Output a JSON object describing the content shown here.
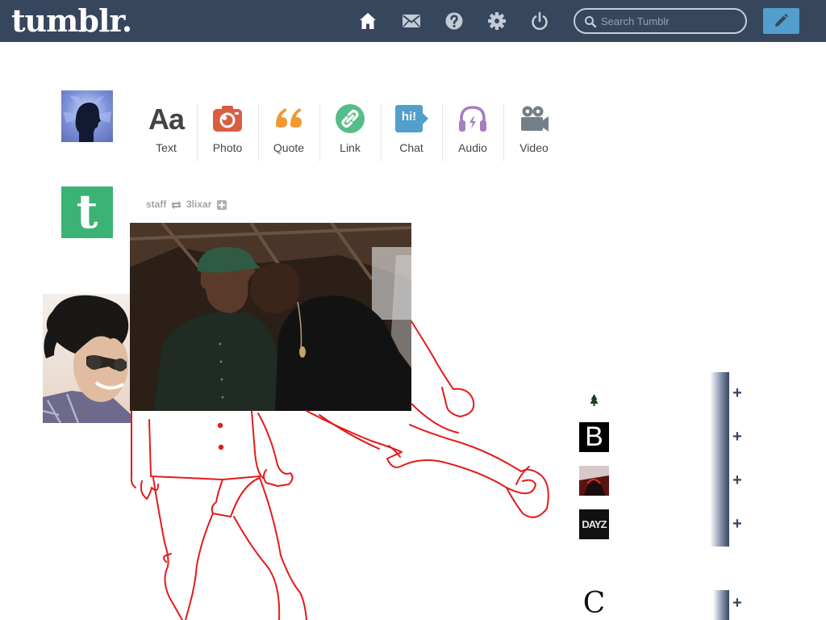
{
  "header": {
    "logo": "tumblr.",
    "search_placeholder": "Search Tumblr",
    "colors": {
      "bar": "#36465d",
      "compose": "#529ecc"
    },
    "nav_icons": [
      "home-icon",
      "mail-icon",
      "help-icon",
      "gear-icon",
      "power-icon"
    ],
    "compose_icon": "pencil-icon"
  },
  "post_types": [
    {
      "label": "Text",
      "icon": "text-aa-icon",
      "color": "#444444"
    },
    {
      "label": "Photo",
      "icon": "camera-icon",
      "color": "#d95e40"
    },
    {
      "label": "Quote",
      "icon": "quote-icon",
      "color": "#f2992e"
    },
    {
      "label": "Link",
      "icon": "link-icon",
      "color": "#56bc8a"
    },
    {
      "label": "Chat",
      "icon": "chat-icon",
      "color": "#529ecc"
    },
    {
      "label": "Audio",
      "icon": "headphones-icon",
      "color": "#a77dc2"
    },
    {
      "label": "Video",
      "icon": "video-camera-icon",
      "color": "#748089"
    }
  ],
  "post": {
    "blog": "staff",
    "reblogged_from": "3lixar",
    "text_aa": "Aa",
    "chat_glyph": "hi!",
    "tumblr_t": "t"
  },
  "recommended": [
    {
      "thumb": "tree-thumbnail",
      "plus": "+"
    },
    {
      "thumb": "letter-b-thumbnail",
      "letter": "B",
      "plus": "+"
    },
    {
      "thumb": "photo-thumbnail",
      "plus": "+"
    },
    {
      "thumb": "dayz-thumbnail",
      "letter": "DAYZ",
      "plus": "+"
    },
    {
      "thumb": "letter-c-thumbnail",
      "letter": "C",
      "plus": "+"
    }
  ]
}
